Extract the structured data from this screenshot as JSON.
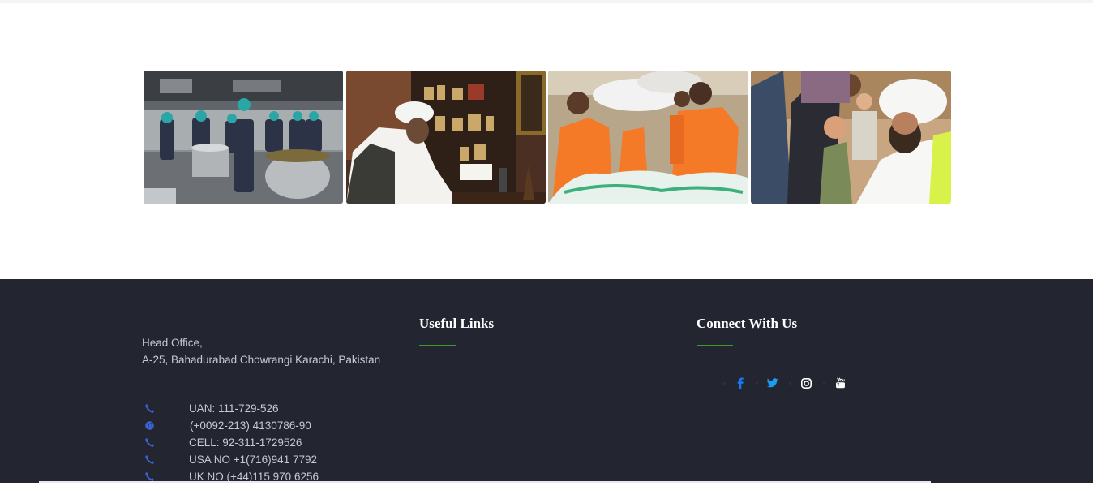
{
  "gallery": {
    "photos": [
      {
        "name": "kitchen-cooking-photo"
      },
      {
        "name": "scholar-at-desk-photo"
      },
      {
        "name": "ration-distribution-photo"
      },
      {
        "name": "children-with-scholar-photo"
      }
    ]
  },
  "footer": {
    "address": {
      "line1": "Head Office,",
      "line2": "A-25, Bahadurabad Chowrangi Karachi, Pakistan"
    },
    "contacts": [
      {
        "icon": "phone-icon",
        "text": "UAN: 111-729-526"
      },
      {
        "icon": "globe-icon",
        "text": "(+0092-213) 4130786-90"
      },
      {
        "icon": "phone-icon",
        "text": "CELL: 92-311-1729526"
      },
      {
        "icon": "phone-icon",
        "text": "USA NO +1(716)941 7792"
      },
      {
        "icon": "phone-icon",
        "text": "UK NO (+44)115 970 6256"
      }
    ],
    "useful_links": {
      "title": "Useful Links"
    },
    "connect": {
      "title": "Connect With Us",
      "socials": [
        {
          "icon": "facebook-icon",
          "color": "#1877f2"
        },
        {
          "icon": "twitter-icon",
          "color": "#1d9bf0"
        },
        {
          "icon": "instagram-icon",
          "color": "#ffffff"
        },
        {
          "icon": "youtube-icon",
          "color": "#ffffff"
        }
      ]
    },
    "colors": {
      "background": "#232530",
      "accent": "#3f9a2c",
      "icon_blue": "#3a63d8"
    }
  }
}
